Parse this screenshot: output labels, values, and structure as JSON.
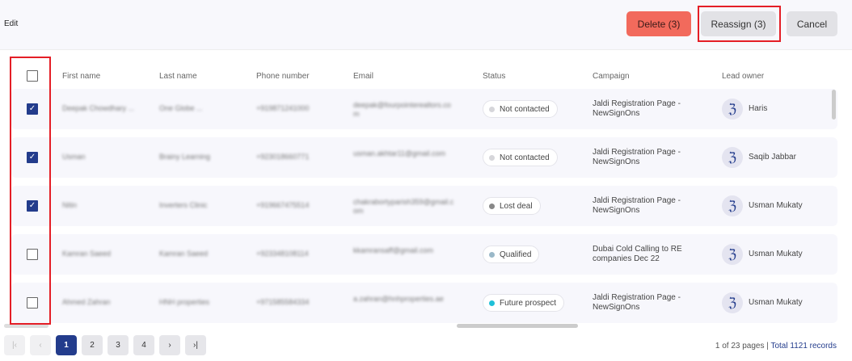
{
  "header": {
    "edit_label": "Edit",
    "delete_label": "Delete (3)",
    "reassign_label": "Reassign (3)",
    "cancel_label": "Cancel"
  },
  "colors": {
    "accent": "#233c8c",
    "delete": "#f26a5c",
    "highlight": "#e41e26"
  },
  "columns": [
    "First name",
    "Last name",
    "Phone number",
    "Email",
    "Status",
    "Campaign",
    "Lead owner"
  ],
  "rows": [
    {
      "checked": true,
      "first": "Deepak Chowdhary ...",
      "last": "One Globe ...",
      "phone": "+919871241000",
      "email": "deepak@fourpointerealtors.co m",
      "status": "Not contacted",
      "status_color": "#d6d6da",
      "campaign": "Jaldi Registration Page - NewSignOns",
      "owner": "Haris"
    },
    {
      "checked": true,
      "first": "Usman",
      "last": "Brainy Learning",
      "phone": "+923018660771",
      "email": "usman.akhtar11@gmail.com",
      "status": "Not contacted",
      "status_color": "#d6d6da",
      "campaign": "Jaldi Registration Page - NewSignOns",
      "owner": "Saqib Jabbar"
    },
    {
      "checked": true,
      "first": "Nitin",
      "last": "Inverters Clinic",
      "phone": "+919667475514",
      "email": "chakrabortyparish359@gmail.c om",
      "status": "Lost deal",
      "status_color": "#888888",
      "campaign": "Jaldi Registration Page - NewSignOns",
      "owner": "Usman Mukaty"
    },
    {
      "checked": false,
      "first": "Kamran Saeed",
      "last": "Kamran Saeed",
      "phone": "+923348108114",
      "email": "kkamransaff@gmail.com",
      "status": "Qualified",
      "status_color": "#9ab8c8",
      "campaign": "Dubai Cold Calling to RE companies Dec 22",
      "owner": "Usman Mukaty"
    },
    {
      "checked": false,
      "first": "Ahmed Zahran",
      "last": "HNH properties",
      "phone": "+971585584334",
      "email": "a.zahran@hnhproperties.ae",
      "status": "Future prospect",
      "status_color": "#1ec0d8",
      "campaign": "Jaldi Registration Page - NewSignOns",
      "owner": "Usman Mukaty"
    }
  ],
  "pagination": {
    "pages": [
      "1",
      "2",
      "3",
      "4"
    ],
    "current": "1",
    "first_icon": "first-page-icon",
    "prev_icon": "prev-page-icon",
    "next_icon": "next-page-icon",
    "last_icon": "last-page-icon",
    "page_info": "1 of 23 pages",
    "separator": "|",
    "total": "Total 1121 records"
  }
}
